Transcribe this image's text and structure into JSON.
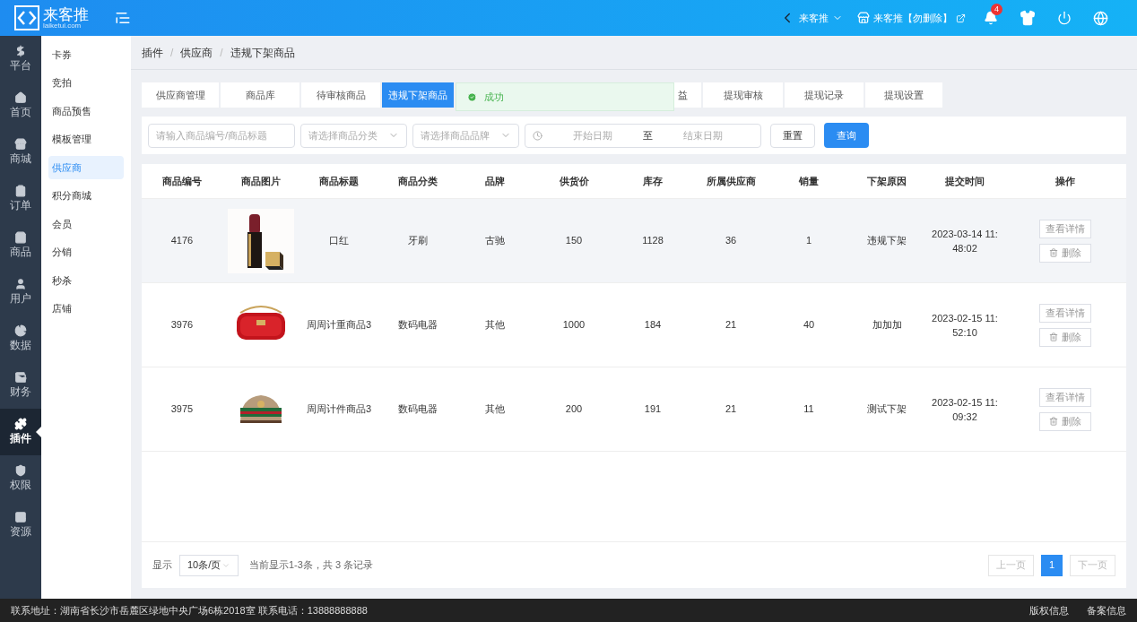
{
  "header": {
    "logo_text": "来客推",
    "logo_domain": "laiketui.com",
    "store": "来客推",
    "account": "来客推【勿删除】",
    "notifications": "4"
  },
  "nav": [
    {
      "label": "平台",
      "selected": false
    },
    {
      "label": "首页",
      "selected": false
    },
    {
      "label": "商城",
      "selected": false
    },
    {
      "label": "订单",
      "selected": false
    },
    {
      "label": "商品",
      "selected": false
    },
    {
      "label": "用户",
      "selected": false
    },
    {
      "label": "数据",
      "selected": false
    },
    {
      "label": "财务",
      "selected": false
    },
    {
      "label": "插件",
      "selected": true
    },
    {
      "label": "权限",
      "selected": false
    },
    {
      "label": "资源",
      "selected": false
    }
  ],
  "submenu": [
    {
      "label": "卡券",
      "selected": false
    },
    {
      "label": "竞拍",
      "selected": false
    },
    {
      "label": "商品预售",
      "selected": false
    },
    {
      "label": "模板管理",
      "selected": false
    },
    {
      "label": "供应商",
      "selected": true
    },
    {
      "label": "积分商城",
      "selected": false
    },
    {
      "label": "会员",
      "selected": false
    },
    {
      "label": "分销",
      "selected": false
    },
    {
      "label": "秒杀",
      "selected": false
    },
    {
      "label": "店铺",
      "selected": false
    }
  ],
  "breadcrumb": {
    "items": [
      "插件",
      "供应商",
      "违规下架商品"
    ],
    "separator": "/"
  },
  "tabs": [
    {
      "label": "供应商管理",
      "selected": false
    },
    {
      "label": "商品库",
      "selected": false
    },
    {
      "label": "待审核商品",
      "selected": false
    },
    {
      "label": "违规下架商品",
      "selected": true
    },
    {
      "label": "益",
      "selected": false
    },
    {
      "label": "提现审核",
      "selected": false
    },
    {
      "label": "提现记录",
      "selected": false
    },
    {
      "label": "提现设置",
      "selected": false
    }
  ],
  "toast": {
    "message": "成功"
  },
  "filters": {
    "search": {
      "placeholder": "请输入商品编号/商品标题"
    },
    "category": {
      "placeholder": "请选择商品分类"
    },
    "brand": {
      "placeholder": "请选择商品品牌"
    },
    "start_date": {
      "placeholder": "开始日期"
    },
    "range_separator": "至",
    "end_date": {
      "placeholder": "结束日期"
    },
    "reset": "重置",
    "query": "查询"
  },
  "table": {
    "columns": [
      "商品编号",
      "商品图片",
      "商品标题",
      "商品分类",
      "品牌",
      "供货价",
      "库存",
      "所属供应商",
      "销量",
      "下架原因",
      "提交时间",
      "操作"
    ],
    "rows": [
      {
        "highlighted": true,
        "id": "4176",
        "image": {
          "kind": "picture"
        },
        "title": "口红",
        "category": "牙刷",
        "brand": "古驰",
        "price": "150",
        "stock": "1128",
        "supplier": "36",
        "sales": "1",
        "reason": "违规下架",
        "time": "2023-03-14 11:\n48:02",
        "actions": [
          "查看详情",
          "删除"
        ]
      },
      {
        "highlighted": false,
        "id": "3976",
        "image": {
          "kind": "picture"
        },
        "title": "周周计重商品3",
        "category": "数码电器",
        "brand": "其他",
        "price": "1000",
        "stock": "184",
        "supplier": "21",
        "sales": "40",
        "reason": "加加加",
        "time": "2023-02-15 11:\n52:10",
        "actions": [
          "查看详情",
          "删除"
        ]
      },
      {
        "highlighted": false,
        "id": "3975",
        "image": {
          "kind": "picture"
        },
        "title": "周周计件商品3",
        "category": "数码电器",
        "brand": "其他",
        "price": "200",
        "stock": "191",
        "supplier": "21",
        "sales": "11",
        "reason": "测试下架",
        "time": "2023-02-15 11:\n09:32",
        "actions": [
          "查看详情",
          "删除"
        ]
      }
    ]
  },
  "pagination": {
    "show_label": "显示",
    "page_size": "10条/页",
    "summary": "当前显示1-3条，共 3 条记录",
    "prev": "上一页",
    "pages": [
      {
        "label": "1",
        "selected": true
      }
    ],
    "next": "下一页"
  },
  "footer": {
    "contact": "联系地址：湖南省长沙市岳麓区绿地中央广场6栋2018室 联系电话：13888888888",
    "links": [
      "版权信息",
      "备案信息"
    ]
  }
}
